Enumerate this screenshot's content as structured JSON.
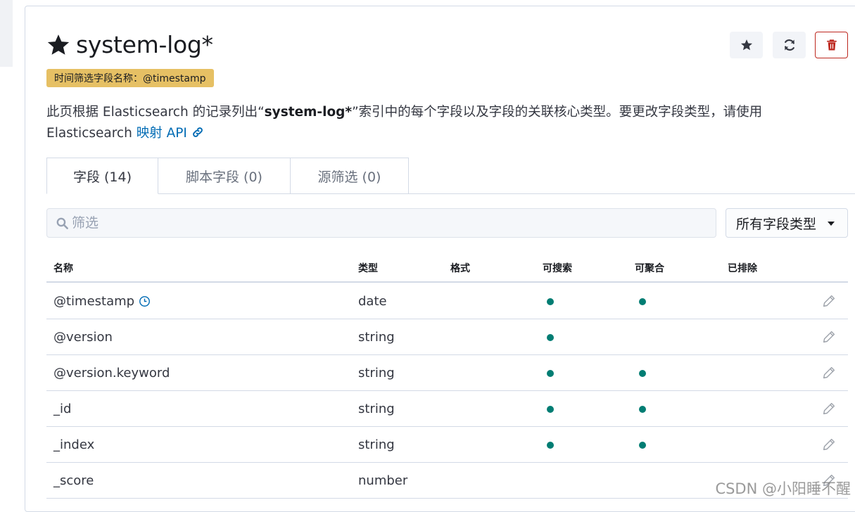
{
  "index_pattern": {
    "title": "system-log*",
    "time_field_badge": "时间筛选字段名称：@timestamp"
  },
  "description": {
    "part1": "此页根据 Elasticsearch 的记录列出“",
    "bold": "system-log*",
    "part2": "”索引中的每个字段以及字段的关联核心类型。要更改字段类型，请使用 Elasticsearch ",
    "link": "映射 API"
  },
  "tabs": [
    {
      "label": "字段 (14)"
    },
    {
      "label": "脚本字段 (0)"
    },
    {
      "label": "源筛选 (0)"
    }
  ],
  "filter": {
    "placeholder": "筛选",
    "type_select": "所有字段类型"
  },
  "table": {
    "headers": [
      "名称",
      "类型",
      "格式",
      "可搜索",
      "可聚合",
      "已排除"
    ],
    "rows": [
      {
        "name": "@timestamp",
        "type": "date",
        "searchable": true,
        "aggregatable": true,
        "time_icon": true
      },
      {
        "name": "@version",
        "type": "string",
        "searchable": true,
        "aggregatable": false
      },
      {
        "name": "@version.keyword",
        "type": "string",
        "searchable": true,
        "aggregatable": true
      },
      {
        "name": "_id",
        "type": "string",
        "searchable": true,
        "aggregatable": true
      },
      {
        "name": "_index",
        "type": "string",
        "searchable": true,
        "aggregatable": true
      },
      {
        "name": "_score",
        "type": "number",
        "searchable": false,
        "aggregatable": false
      }
    ]
  },
  "watermark": "CSDN @小阳睡不醒",
  "colors": {
    "badge": "#e6c064",
    "link": "#006bb4",
    "dot": "#017d73",
    "danger": "#bd271e"
  }
}
